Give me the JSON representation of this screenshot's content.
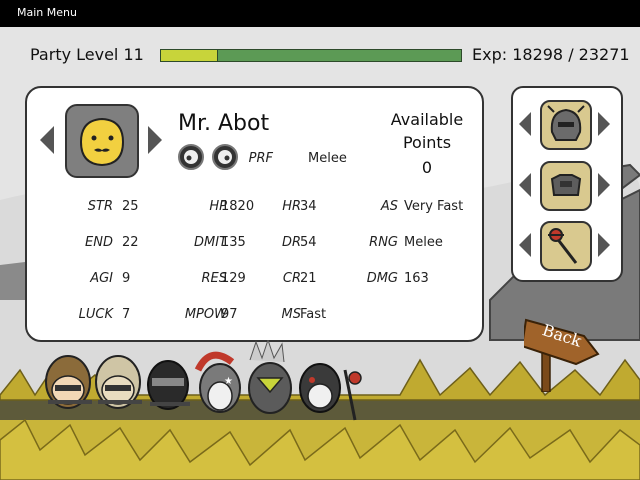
{
  "topbar": {
    "main_menu": "Main Menu"
  },
  "party": {
    "level_label": "Party Level 11",
    "exp_label": "Exp: 18298 / 23271",
    "exp_current": 18298,
    "exp_max": 23271,
    "exp_shown_fraction": 0.19
  },
  "character": {
    "name": "Mr. Abot",
    "available_label_line1": "Available",
    "available_label_line2": "Points",
    "available_points": "0",
    "prf_label": "PRF",
    "prf_value": "Melee"
  },
  "stats": [
    {
      "label": "STR",
      "value": "25"
    },
    {
      "label": "HP",
      "value": "1820"
    },
    {
      "label": "HR",
      "value": "34"
    },
    {
      "label": "AS",
      "value": "Very Fast"
    },
    {
      "label": "END",
      "value": "22"
    },
    {
      "label": "DMIT",
      "value": "135"
    },
    {
      "label": "DR",
      "value": "54"
    },
    {
      "label": "RNG",
      "value": "Melee"
    },
    {
      "label": "AGI",
      "value": "9"
    },
    {
      "label": "RES",
      "value": "129"
    },
    {
      "label": "CR",
      "value": "21"
    },
    {
      "label": "DMG",
      "value": "163"
    },
    {
      "label": "LUCK",
      "value": "7"
    },
    {
      "label": "MPOW",
      "value": "97"
    },
    {
      "label": "MS",
      "value": "Fast"
    }
  ],
  "equipment": {
    "slots": [
      "helmet-icon",
      "armor-icon",
      "mace-weapon-icon"
    ]
  },
  "back_button": {
    "label": "Back"
  },
  "colors": {
    "exp_bar": "#5c9a55",
    "exp_fill": "#c8d43a",
    "portrait_face": "#f2d040",
    "slot_bg": "#d9c98f"
  }
}
